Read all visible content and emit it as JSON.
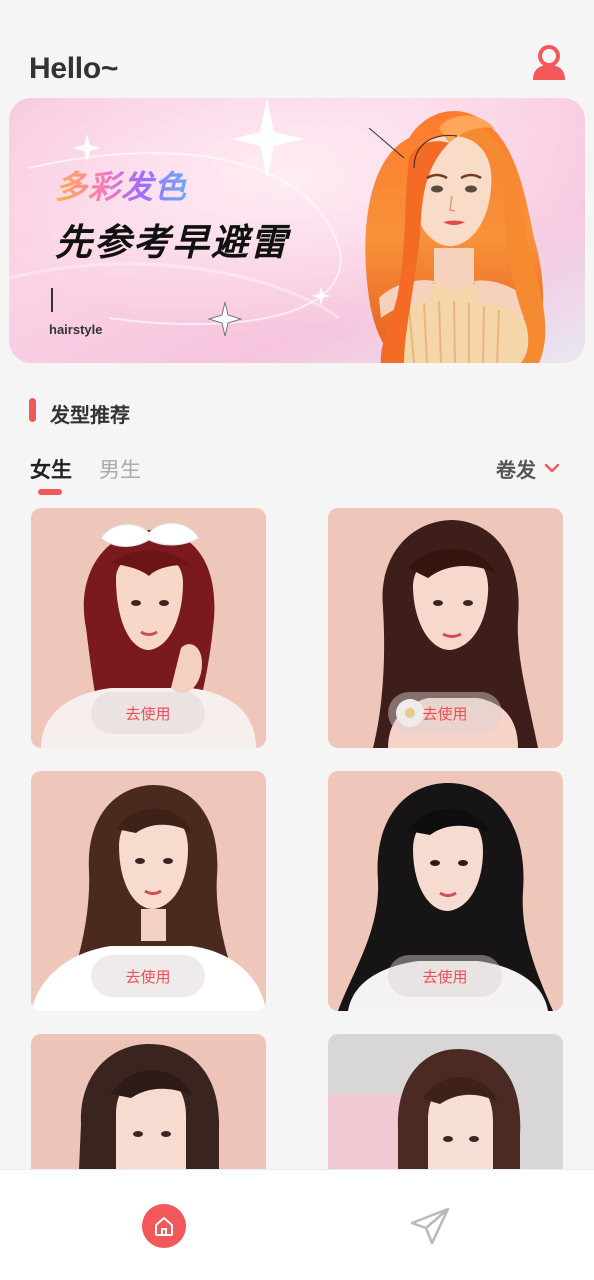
{
  "header": {
    "greeting": "Hello~",
    "profile_icon": "person-icon"
  },
  "banner": {
    "line1": "多彩发色",
    "line2": "先参考早避雷",
    "sub": "hairstyle"
  },
  "section": {
    "title": "发型推荐"
  },
  "tabs": [
    {
      "label": "女生",
      "active": true
    },
    {
      "label": "男生",
      "active": false
    }
  ],
  "filter": {
    "label": "卷发",
    "icon": "chevron-down-icon"
  },
  "cards": [
    {
      "button": "去使用"
    },
    {
      "button": "去使用"
    },
    {
      "button": "去使用"
    },
    {
      "button": "去使用"
    },
    {
      "button": ""
    },
    {
      "button": ""
    }
  ],
  "bottom_nav": {
    "items": [
      {
        "icon": "home-icon",
        "active": true
      },
      {
        "icon": "send-icon",
        "active": false
      }
    ]
  },
  "colors": {
    "accent": "#f2585a",
    "background": "#f6f5f6",
    "card_bg": "#efc9bd"
  }
}
